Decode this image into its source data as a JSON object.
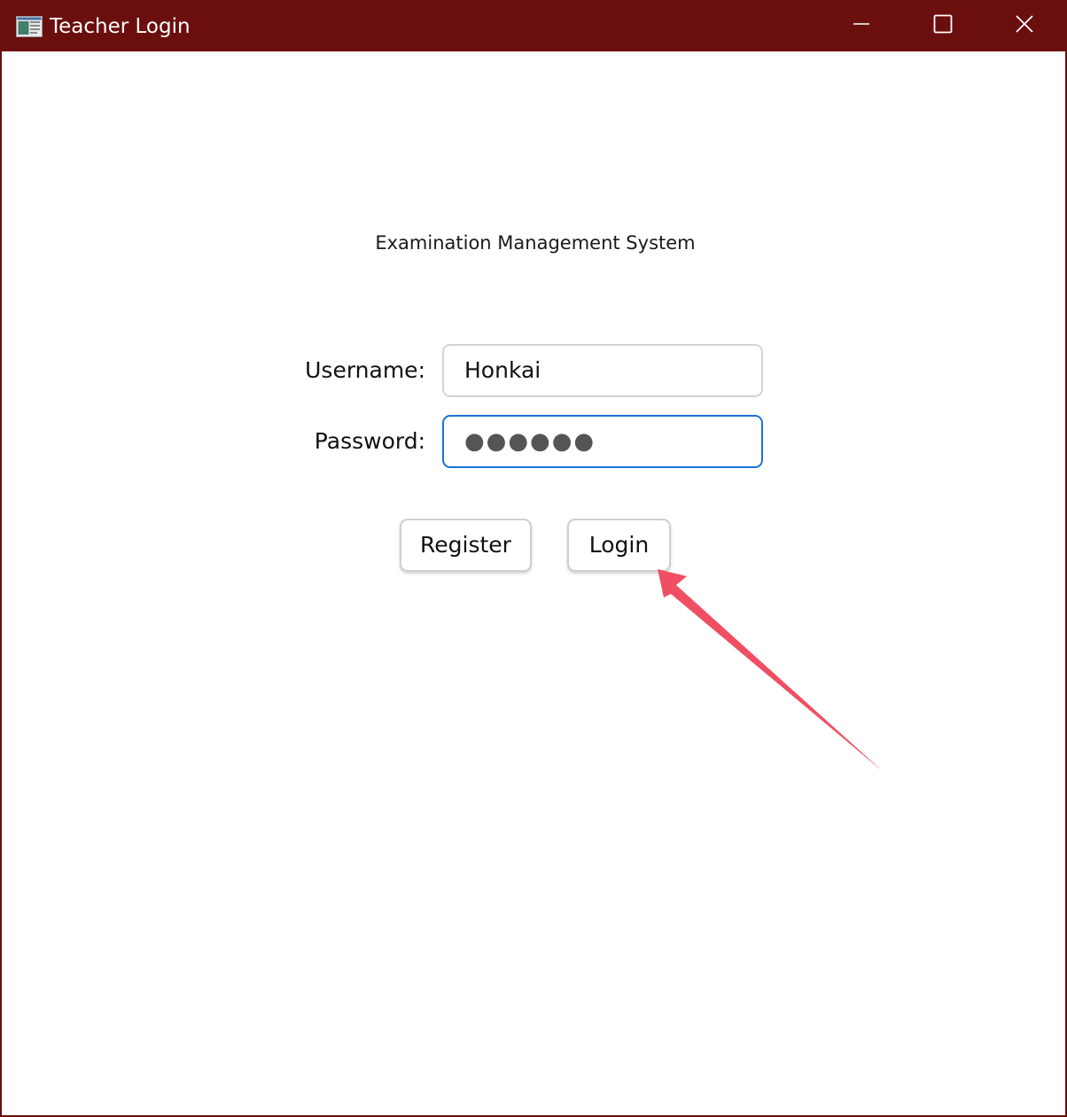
{
  "window": {
    "title": "Teacher Login",
    "titlebar_color": "#6b0e0e",
    "app_icon": "app-window-icon",
    "controls": {
      "minimize_icon": "minimize-icon",
      "maximize_icon": "maximize-icon",
      "close_icon": "close-icon"
    }
  },
  "main": {
    "heading": "Examination Management System",
    "username": {
      "label": "Username:",
      "value": "Honkai"
    },
    "password": {
      "label": "Password:",
      "masked_value": "●●●●●●",
      "focused": true,
      "focus_color": "#1a73d4"
    },
    "buttons": {
      "register_label": "Register",
      "login_label": "Login"
    }
  },
  "annotation": {
    "icon": "pointer-arrow-icon",
    "color": "#f04f63",
    "points_to": "login-button"
  }
}
